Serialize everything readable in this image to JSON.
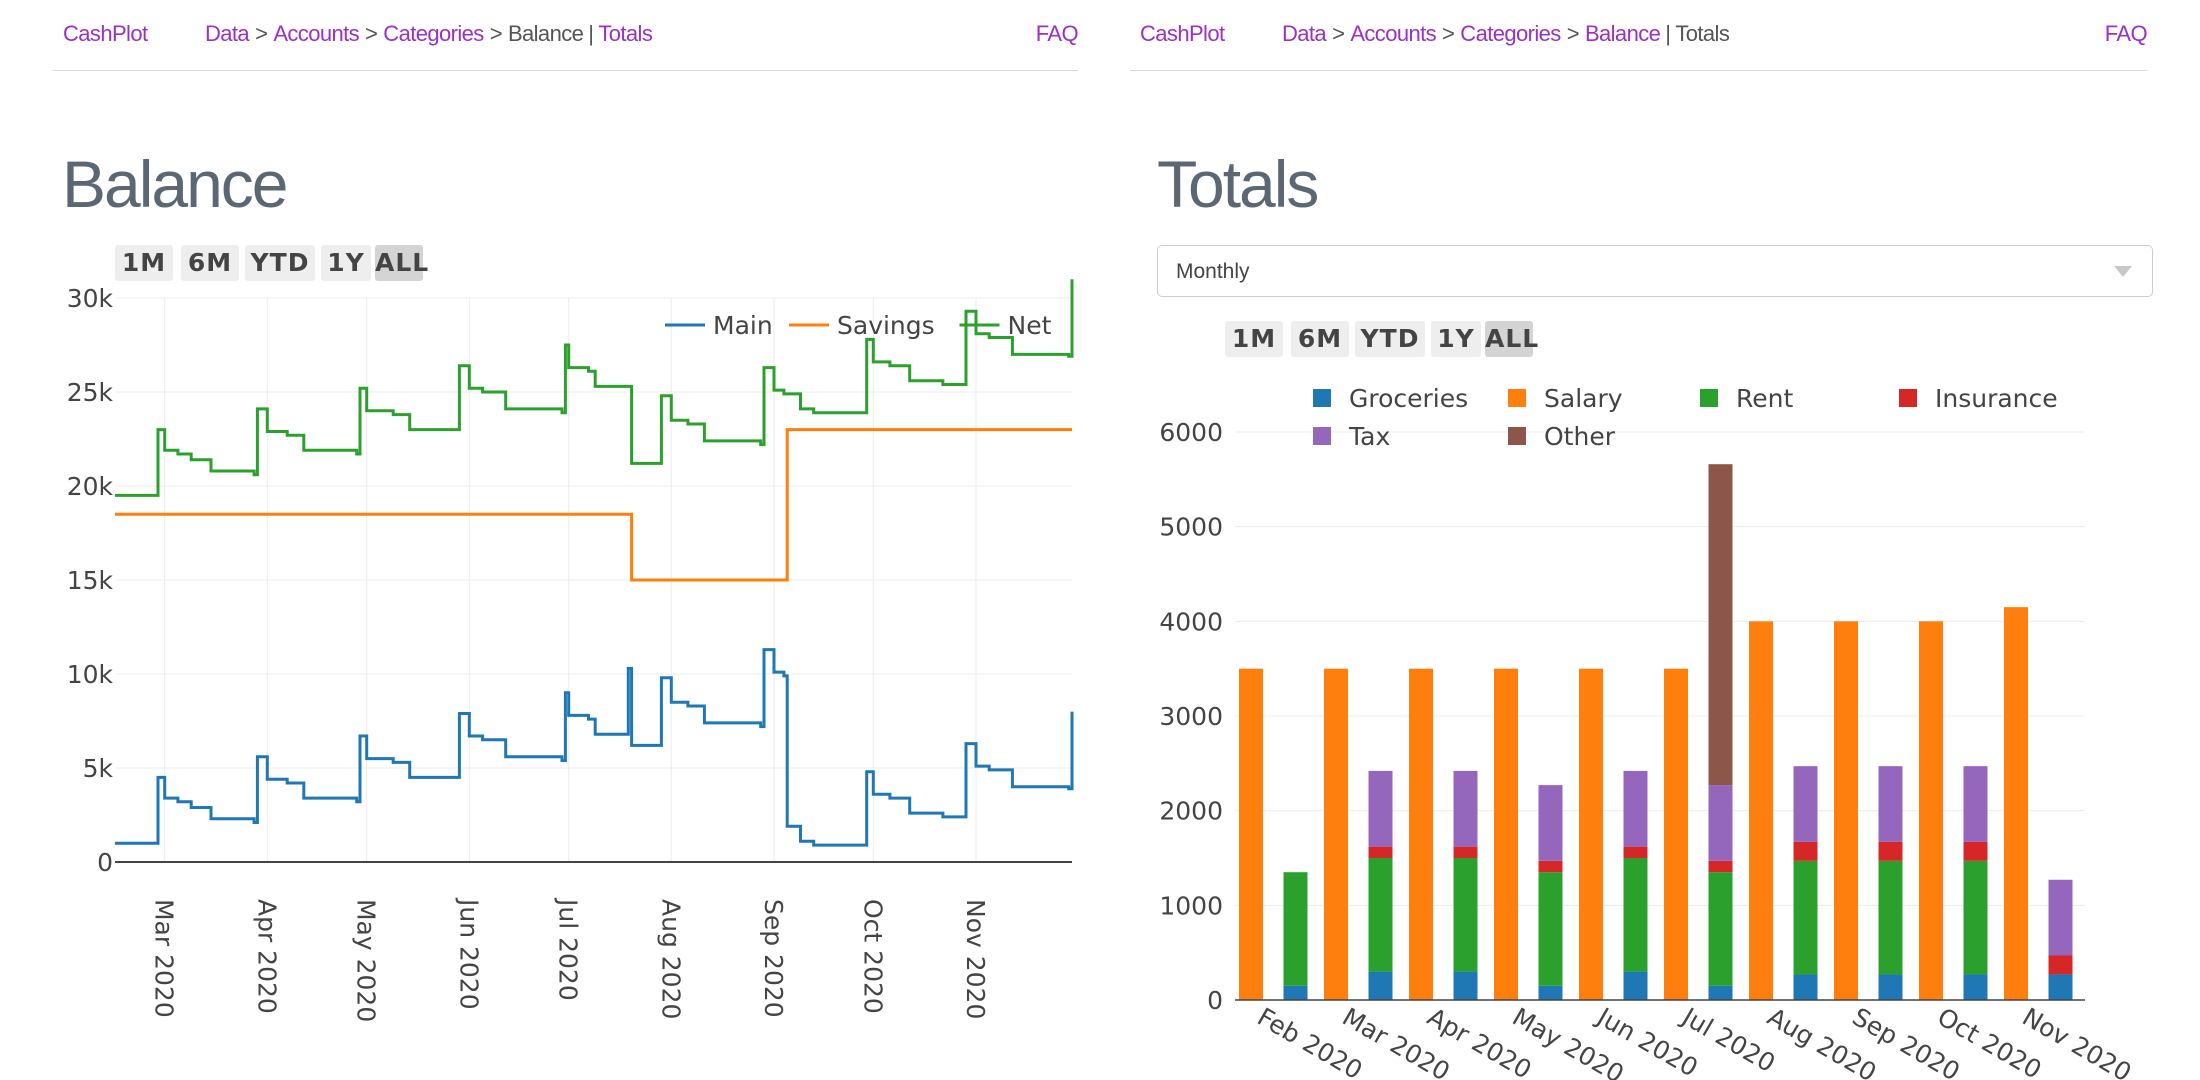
{
  "left": {
    "nav": {
      "brand": "CashPlot",
      "crumbs": [
        "Data",
        "Accounts",
        "Categories",
        "Balance",
        "Totals"
      ],
      "faq": "FAQ"
    },
    "title": "Balance",
    "range_buttons": [
      "1M",
      "6M",
      "YTD",
      "1Y",
      "ALL"
    ],
    "active_range": "ALL"
  },
  "right": {
    "nav": {
      "brand": "CashPlot",
      "crumbs": [
        "Data",
        "Accounts",
        "Categories",
        "Balance",
        "Totals"
      ],
      "faq": "FAQ"
    },
    "title": "Totals",
    "dropdown_value": "Monthly",
    "range_buttons": [
      "1M",
      "6M",
      "YTD",
      "1Y",
      "ALL"
    ],
    "active_range": "ALL"
  },
  "colors": {
    "accent": "#9b30c9",
    "main": "#1f77b4",
    "savings": "#ff7f0e",
    "net": "#2ca02c",
    "groceries": "#1f77b4",
    "salary": "#ff7f0e",
    "rent": "#2ca02c",
    "insurance": "#d62728",
    "tax": "#9467bd",
    "other": "#8c564b"
  },
  "chart_data": [
    {
      "type": "line",
      "line_shape": "step",
      "x_type": "date",
      "x_ticks": [
        "Mar 2020",
        "Apr 2020",
        "May 2020",
        "Jun 2020",
        "Jul 2020",
        "Aug 2020",
        "Sep 2020",
        "Oct 2020",
        "Nov 2020"
      ],
      "y_ticks": [
        "0",
        "5k",
        "10k",
        "15k",
        "20k",
        "25k",
        "30k"
      ],
      "ylim": [
        0,
        30000
      ],
      "xlim": [
        "2020-02-15",
        "2020-11-30"
      ],
      "legend_position": "top-right",
      "grid": true,
      "series": [
        {
          "name": "Main",
          "color": "#1f77b4",
          "points": [
            [
              "2020-02-15",
              1000
            ],
            [
              "2020-02-28",
              4500
            ],
            [
              "2020-03-01",
              3400
            ],
            [
              "2020-03-05",
              3200
            ],
            [
              "2020-03-09",
              2900
            ],
            [
              "2020-03-15",
              2300
            ],
            [
              "2020-03-28",
              2100
            ],
            [
              "2020-03-29",
              5600
            ],
            [
              "2020-04-01",
              4400
            ],
            [
              "2020-04-07",
              4200
            ],
            [
              "2020-04-12",
              3400
            ],
            [
              "2020-04-28",
              3200
            ],
            [
              "2020-04-29",
              6700
            ],
            [
              "2020-05-01",
              5500
            ],
            [
              "2020-05-09",
              5300
            ],
            [
              "2020-05-14",
              4500
            ],
            [
              "2020-05-29",
              7900
            ],
            [
              "2020-06-01",
              6700
            ],
            [
              "2020-06-05",
              6500
            ],
            [
              "2020-06-12",
              5600
            ],
            [
              "2020-06-29",
              5400
            ],
            [
              "2020-06-30",
              9000
            ],
            [
              "2020-07-01",
              7800
            ],
            [
              "2020-07-07",
              7600
            ],
            [
              "2020-07-09",
              6800
            ],
            [
              "2020-07-19",
              10300
            ],
            [
              "2020-07-20",
              6200
            ],
            [
              "2020-07-28",
              6200
            ],
            [
              "2020-07-29",
              9800
            ],
            [
              "2020-08-01",
              8500
            ],
            [
              "2020-08-06",
              8300
            ],
            [
              "2020-08-11",
              7400
            ],
            [
              "2020-08-28",
              7200
            ],
            [
              "2020-08-29",
              11300
            ],
            [
              "2020-09-01",
              10100
            ],
            [
              "2020-09-04",
              9900
            ],
            [
              "2020-09-05",
              1900
            ],
            [
              "2020-09-09",
              1100
            ],
            [
              "2020-09-13",
              900
            ],
            [
              "2020-09-28",
              900
            ],
            [
              "2020-09-29",
              4800
            ],
            [
              "2020-10-01",
              3600
            ],
            [
              "2020-10-06",
              3400
            ],
            [
              "2020-10-12",
              2600
            ],
            [
              "2020-10-22",
              2400
            ],
            [
              "2020-10-28",
              2400
            ],
            [
              "2020-10-29",
              6300
            ],
            [
              "2020-11-01",
              5100
            ],
            [
              "2020-11-05",
              4900
            ],
            [
              "2020-11-12",
              4000
            ],
            [
              "2020-11-29",
              3900
            ],
            [
              "2020-11-30",
              8000
            ]
          ]
        },
        {
          "name": "Savings",
          "color": "#ff7f0e",
          "points": [
            [
              "2020-02-15",
              18500
            ],
            [
              "2020-07-20",
              15000
            ],
            [
              "2020-09-05",
              23000
            ],
            [
              "2020-11-30",
              23000
            ]
          ]
        },
        {
          "name": "Net",
          "color": "#2ca02c",
          "points": [
            [
              "2020-02-15",
              19500
            ],
            [
              "2020-02-28",
              23000
            ],
            [
              "2020-03-01",
              21900
            ],
            [
              "2020-03-05",
              21700
            ],
            [
              "2020-03-09",
              21400
            ],
            [
              "2020-03-15",
              20800
            ],
            [
              "2020-03-28",
              20600
            ],
            [
              "2020-03-29",
              24100
            ],
            [
              "2020-04-01",
              22900
            ],
            [
              "2020-04-07",
              22700
            ],
            [
              "2020-04-12",
              21900
            ],
            [
              "2020-04-28",
              21700
            ],
            [
              "2020-04-29",
              25200
            ],
            [
              "2020-05-01",
              24000
            ],
            [
              "2020-05-09",
              23800
            ],
            [
              "2020-05-14",
              23000
            ],
            [
              "2020-05-29",
              26400
            ],
            [
              "2020-06-01",
              25200
            ],
            [
              "2020-06-05",
              25000
            ],
            [
              "2020-06-12",
              24100
            ],
            [
              "2020-06-29",
              23900
            ],
            [
              "2020-06-30",
              27500
            ],
            [
              "2020-07-01",
              26300
            ],
            [
              "2020-07-07",
              26100
            ],
            [
              "2020-07-09",
              25300
            ],
            [
              "2020-07-20",
              21200
            ],
            [
              "2020-07-28",
              21200
            ],
            [
              "2020-07-29",
              24800
            ],
            [
              "2020-08-01",
              23500
            ],
            [
              "2020-08-06",
              23300
            ],
            [
              "2020-08-11",
              22400
            ],
            [
              "2020-08-28",
              22200
            ],
            [
              "2020-08-29",
              26300
            ],
            [
              "2020-09-01",
              25100
            ],
            [
              "2020-09-04",
              24900
            ],
            [
              "2020-09-05",
              24900
            ],
            [
              "2020-09-09",
              24100
            ],
            [
              "2020-09-13",
              23900
            ],
            [
              "2020-09-28",
              23900
            ],
            [
              "2020-09-29",
              27800
            ],
            [
              "2020-10-01",
              26600
            ],
            [
              "2020-10-06",
              26400
            ],
            [
              "2020-10-12",
              25600
            ],
            [
              "2020-10-22",
              25400
            ],
            [
              "2020-10-28",
              25400
            ],
            [
              "2020-10-29",
              29300
            ],
            [
              "2020-11-01",
              28100
            ],
            [
              "2020-11-05",
              27900
            ],
            [
              "2020-11-12",
              27000
            ],
            [
              "2020-11-29",
              26900
            ],
            [
              "2020-11-30",
              31000
            ]
          ]
        }
      ]
    },
    {
      "type": "bar",
      "barmode": "grouped-and-stacked",
      "categories": [
        "Feb 2020",
        "Mar 2020",
        "Apr 2020",
        "May 2020",
        "Jun 2020",
        "Jul 2020",
        "Aug 2020",
        "Sep 2020",
        "Oct 2020",
        "Nov 2020"
      ],
      "y_ticks": [
        "0",
        "1000",
        "2000",
        "3000",
        "4000",
        "5000",
        "6000"
      ],
      "ylim": [
        0,
        6000
      ],
      "legend_position": "top",
      "legend_order": [
        "Groceries",
        "Salary",
        "Rent",
        "Insurance",
        "Tax",
        "Other"
      ],
      "grid": true,
      "income": {
        "series": [
          {
            "name": "Salary",
            "color": "#ff7f0e",
            "values": [
              3500,
              3500,
              3500,
              3500,
              3500,
              3500,
              4000,
              4000,
              4000,
              4150
            ]
          }
        ]
      },
      "expenses": {
        "series": [
          {
            "name": "Groceries",
            "color": "#1f77b4",
            "values": [
              150,
              300,
              300,
              150,
              300,
              150,
              270,
              270,
              270,
              270
            ]
          },
          {
            "name": "Rent",
            "color": "#2ca02c",
            "values": [
              1200,
              1200,
              1200,
              1200,
              1200,
              1200,
              1200,
              1200,
              1200,
              0
            ]
          },
          {
            "name": "Insurance",
            "color": "#d62728",
            "values": [
              0,
              120,
              120,
              120,
              120,
              120,
              200,
              200,
              200,
              200
            ]
          },
          {
            "name": "Tax",
            "color": "#9467bd",
            "values": [
              0,
              800,
              800,
              800,
              800,
              800,
              800,
              800,
              800,
              800
            ]
          },
          {
            "name": "Other",
            "color": "#8c564b",
            "values": [
              0,
              0,
              0,
              0,
              0,
              3390,
              0,
              0,
              0,
              0
            ]
          }
        ]
      }
    }
  ]
}
